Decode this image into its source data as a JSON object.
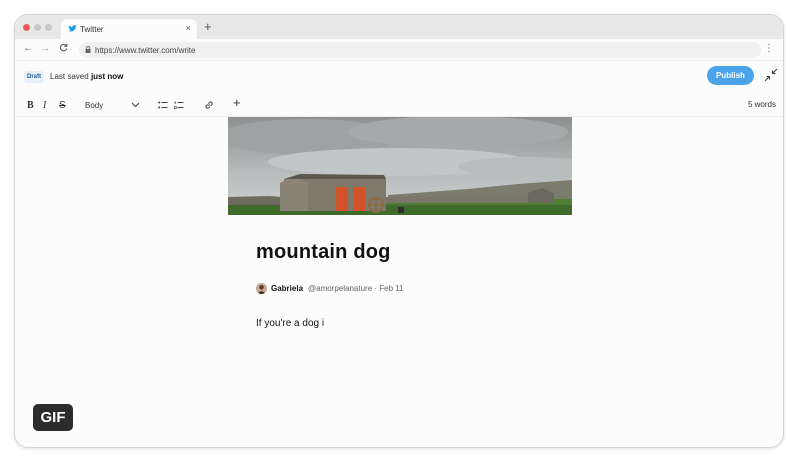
{
  "browser": {
    "tab_title": "Twitter",
    "tab_close": "×",
    "new_tab": "+",
    "url": "https://www.twitter.com/write",
    "back": "←",
    "forward": "→",
    "reload": "C",
    "menu": "⋮"
  },
  "editor": {
    "status_badge": "Draft",
    "saved_prefix": "Last saved",
    "saved_time": "just now",
    "publish_label": "Publish",
    "style_dropdown": "Body",
    "word_count": "5 words",
    "accent_color": "#4ba4ea"
  },
  "toolbar": {
    "bold": "B",
    "italic": "I",
    "strike": "S",
    "chevron": "⌄",
    "add": "+"
  },
  "article": {
    "title": "mountain dog",
    "author_name": "Gabriela",
    "author_meta": "@amorpelanature · Feb 11",
    "body": "If you're a dog i"
  },
  "overlay": {
    "gif_label": "GIF"
  }
}
